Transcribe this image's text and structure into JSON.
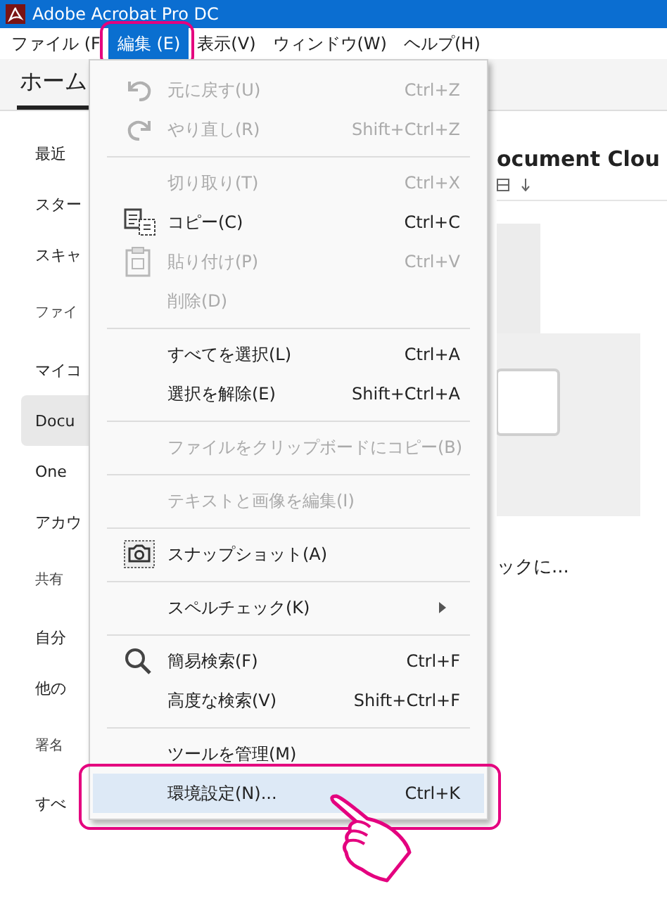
{
  "window": {
    "title": "Adobe Acrobat Pro DC"
  },
  "menu_bar": [
    {
      "label": "ファイル (F",
      "selected": false
    },
    {
      "label": "編集 (E)",
      "selected": true
    },
    {
      "label": "表示(V)",
      "selected": false
    },
    {
      "label": "ウィンドウ(W)",
      "selected": false
    },
    {
      "label": "ヘルプ(H)",
      "selected": false
    }
  ],
  "tabs": [
    {
      "label": "ホーム",
      "selected": true
    }
  ],
  "sidebar": {
    "items": [
      {
        "kind": "item",
        "label": "最近",
        "selected": false
      },
      {
        "kind": "item",
        "label": "スター",
        "selected": false
      },
      {
        "kind": "item",
        "label": "スキャ",
        "selected": false
      },
      {
        "kind": "header",
        "label": "ファイ"
      },
      {
        "kind": "item",
        "label": "マイコ",
        "selected": false
      },
      {
        "kind": "item",
        "label": "Docu",
        "selected": true
      },
      {
        "kind": "item",
        "label": "One",
        "selected": false
      },
      {
        "kind": "item",
        "label": "アカウ",
        "selected": false
      },
      {
        "kind": "header",
        "label": "共有"
      },
      {
        "kind": "item",
        "label": "自分",
        "selected": false
      },
      {
        "kind": "item",
        "label": "他の",
        "selected": false
      },
      {
        "kind": "header",
        "label": "署名"
      },
      {
        "kind": "item",
        "label": "すべ",
        "selected": false
      }
    ]
  },
  "content": {
    "heading": "ocument Clou",
    "caption": "ックに..."
  },
  "edit_menu": {
    "items": [
      {
        "kind": "item",
        "label": "元に戻す(U)",
        "shortcut": "Ctrl+Z",
        "disabled": true,
        "selected": false
      },
      {
        "kind": "item",
        "label": "やり直し(R)",
        "shortcut": "Shift+Ctrl+Z",
        "disabled": true,
        "selected": false
      },
      {
        "kind": "separator"
      },
      {
        "kind": "item",
        "label": "切り取り(T)",
        "shortcut": "Ctrl+X",
        "disabled": true,
        "selected": false
      },
      {
        "kind": "item",
        "label": "コピー(C)",
        "shortcut": "Ctrl+C",
        "disabled": false,
        "selected": false
      },
      {
        "kind": "item",
        "label": "貼り付け(P)",
        "shortcut": "Ctrl+V",
        "disabled": true,
        "selected": false
      },
      {
        "kind": "item",
        "label": "削除(D)",
        "disabled": true,
        "selected": false
      },
      {
        "kind": "separator"
      },
      {
        "kind": "item",
        "label": "すべてを選択(L)",
        "shortcut": "Ctrl+A",
        "disabled": false,
        "selected": false
      },
      {
        "kind": "item",
        "label": "選択を解除(E)",
        "shortcut": "Shift+Ctrl+A",
        "disabled": false,
        "selected": false
      },
      {
        "kind": "separator"
      },
      {
        "kind": "item",
        "label": "ファイルをクリップボードにコピー(B)",
        "disabled": true,
        "selected": false
      },
      {
        "kind": "separator"
      },
      {
        "kind": "item",
        "label": "テキストと画像を編集(I)",
        "disabled": true,
        "selected": false
      },
      {
        "kind": "separator"
      },
      {
        "kind": "item",
        "label": "スナップショット(A)",
        "disabled": false,
        "selected": false
      },
      {
        "kind": "separator"
      },
      {
        "kind": "submenu",
        "label": "スペルチェック(K)",
        "disabled": false,
        "selected": false
      },
      {
        "kind": "separator"
      },
      {
        "kind": "item",
        "label": "簡易検索(F)",
        "shortcut": "Ctrl+F",
        "disabled": false,
        "selected": false
      },
      {
        "kind": "item",
        "label": "高度な検索(V)",
        "shortcut": "Shift+Ctrl+F",
        "disabled": false,
        "selected": false
      },
      {
        "kind": "separator"
      },
      {
        "kind": "item",
        "label": "ツールを管理(M)",
        "disabled": false,
        "selected": false
      },
      {
        "kind": "item",
        "label": "環境設定(N)...",
        "shortcut": "Ctrl+K",
        "disabled": false,
        "selected": true
      }
    ]
  }
}
